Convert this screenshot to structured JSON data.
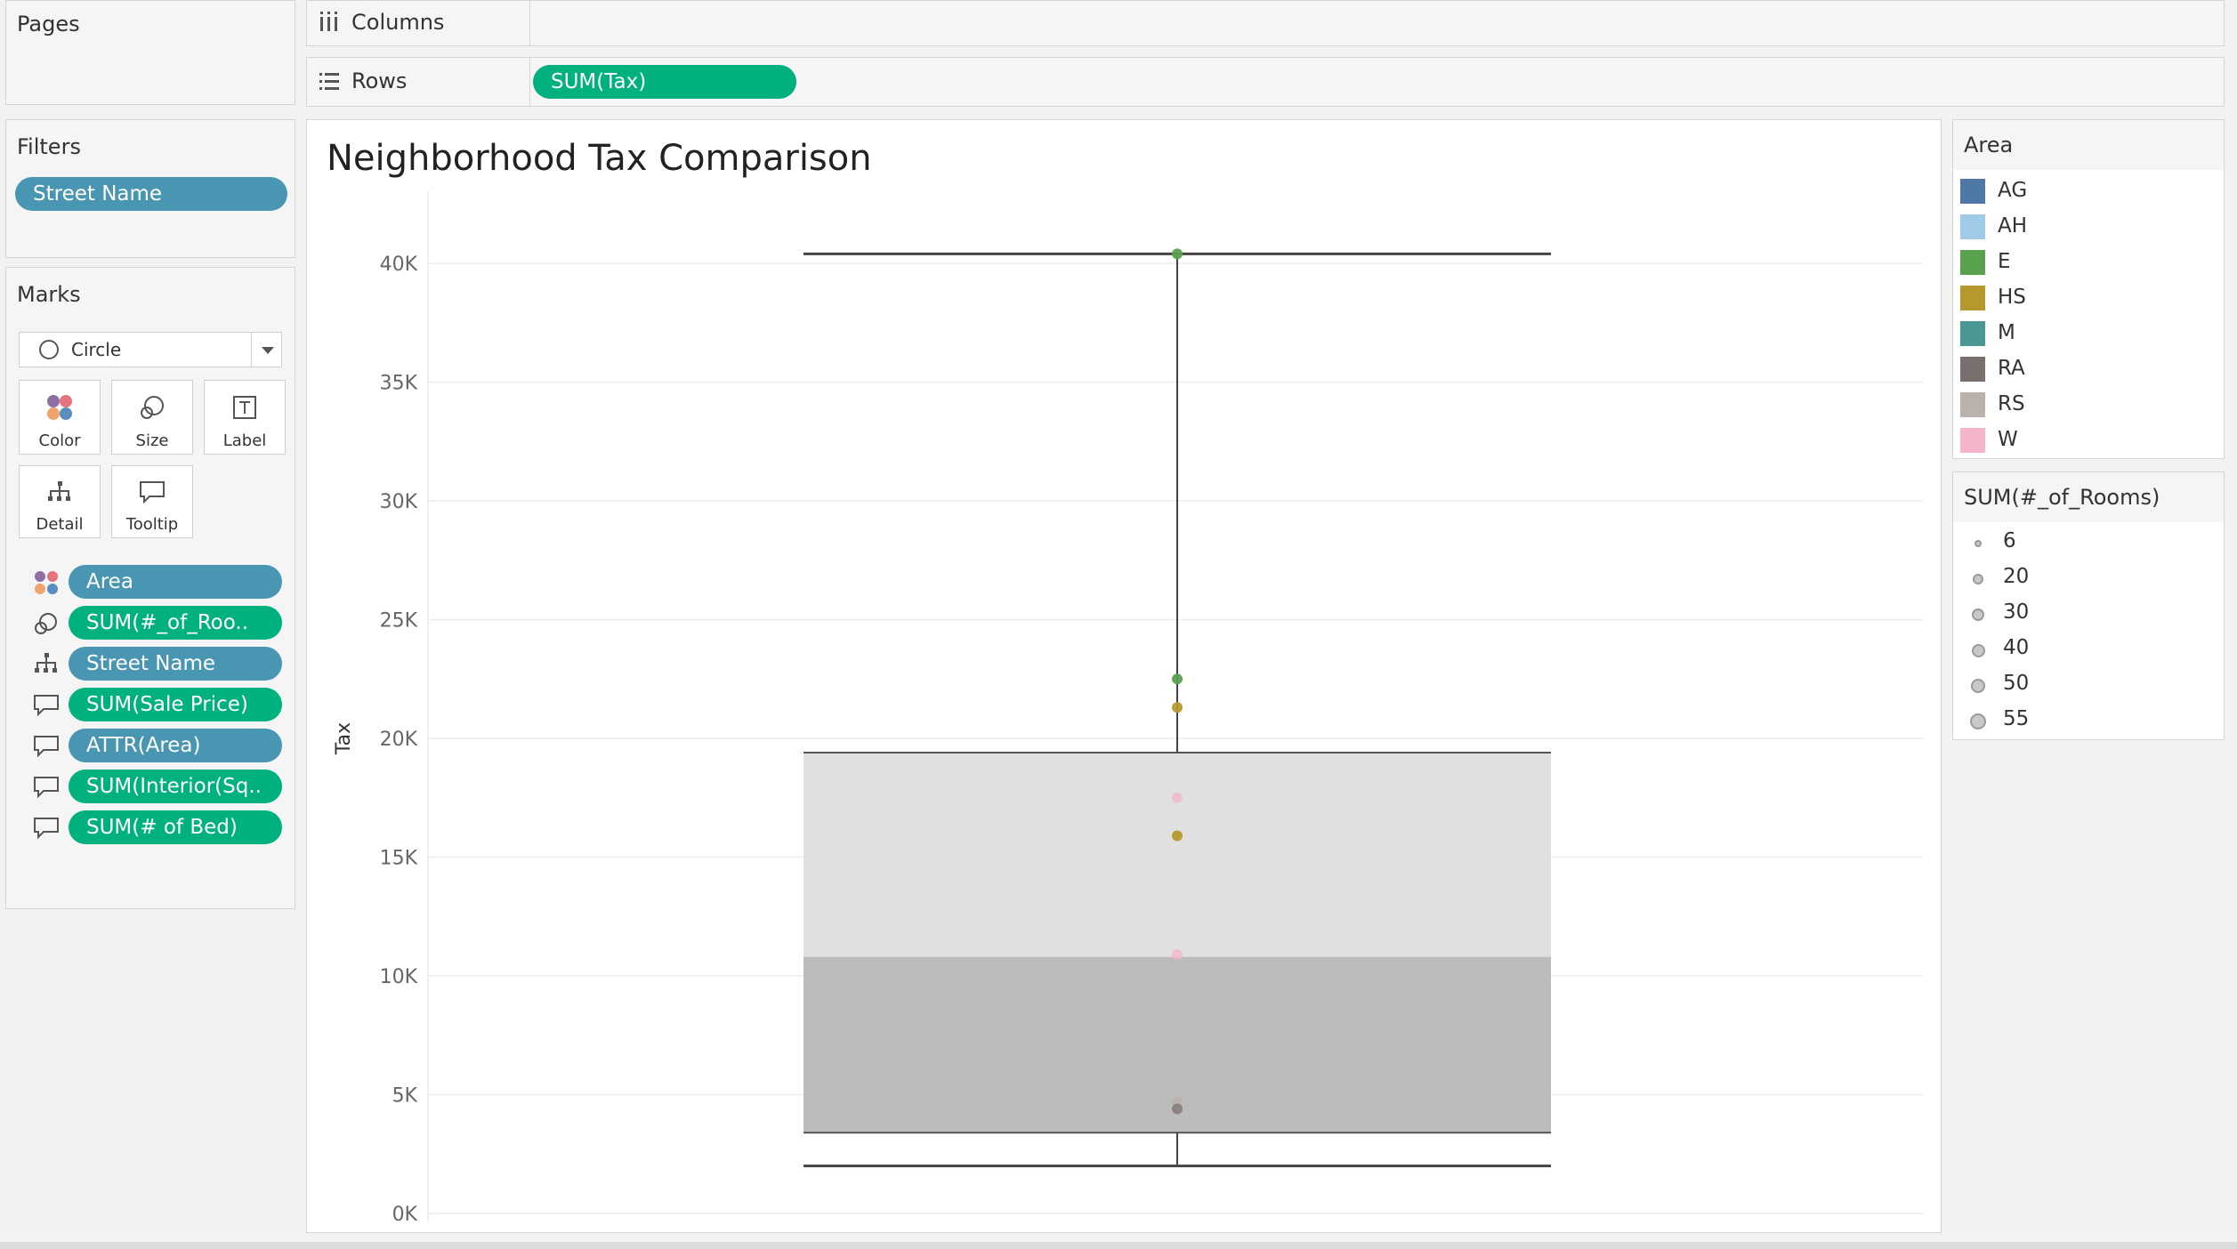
{
  "pages": {
    "title": "Pages"
  },
  "filters": {
    "title": "Filters",
    "items": [
      "Street Name"
    ]
  },
  "marks": {
    "title": "Marks",
    "type": "Circle",
    "cards": [
      "Color",
      "Size",
      "Label",
      "Detail",
      "Tooltip"
    ],
    "fields": [
      {
        "icon": "color-icon",
        "label": "Area",
        "color": "blue"
      },
      {
        "icon": "size-icon",
        "label": "SUM(#_of_Roo..",
        "color": "green"
      },
      {
        "icon": "detail-icon",
        "label": "Street Name",
        "color": "blue"
      },
      {
        "icon": "tooltip-icon",
        "label": "SUM(Sale Price)",
        "color": "green"
      },
      {
        "icon": "tooltip-icon",
        "label": "ATTR(Area)",
        "color": "blue"
      },
      {
        "icon": "tooltip-icon",
        "label": "SUM(Interior(Sq..",
        "color": "green"
      },
      {
        "icon": "tooltip-icon",
        "label": "SUM(# of Bed)",
        "color": "green"
      }
    ]
  },
  "shelves": {
    "columns_label": "Columns",
    "rows_label": "Rows",
    "rows_pill": "SUM(Tax)"
  },
  "chart": {
    "title": "Neighborhood Tax Comparison"
  },
  "chart_data": {
    "type": "scatter",
    "title": "Neighborhood Tax Comparison",
    "xlabel": "",
    "ylabel": "Tax",
    "ylim": [
      0,
      40000
    ],
    "yticks": [
      "0K",
      "5K",
      "10K",
      "15K",
      "20K",
      "25K",
      "30K",
      "35K",
      "40K"
    ],
    "grid": true,
    "boxplot": {
      "min": 2000,
      "q1": 3400,
      "median": 10800,
      "q3": 19400,
      "max": 40400
    },
    "points": [
      {
        "area": "E",
        "tax": 40400
      },
      {
        "area": "E",
        "tax": 22500
      },
      {
        "area": "HS",
        "tax": 21300
      },
      {
        "area": "W",
        "tax": 17500
      },
      {
        "area": "HS",
        "tax": 15900
      },
      {
        "area": "W",
        "tax": 10900
      },
      {
        "area": "RS",
        "tax": 4700
      },
      {
        "area": "RA",
        "tax": 4400
      }
    ]
  },
  "legend_area": {
    "title": "Area",
    "items": [
      {
        "label": "AG",
        "color": "#4e79a7"
      },
      {
        "label": "AH",
        "color": "#a0cbe8"
      },
      {
        "label": "E",
        "color": "#59a14f"
      },
      {
        "label": "HS",
        "color": "#b6992d"
      },
      {
        "label": "M",
        "color": "#499894"
      },
      {
        "label": "RA",
        "color": "#79706e"
      },
      {
        "label": "RS",
        "color": "#bab0ac"
      },
      {
        "label": "W",
        "color": "#f5b5c8"
      }
    ]
  },
  "legend_size": {
    "title": "SUM(#_of_Rooms)",
    "items": [
      "6",
      "20",
      "30",
      "40",
      "50",
      "55"
    ]
  }
}
